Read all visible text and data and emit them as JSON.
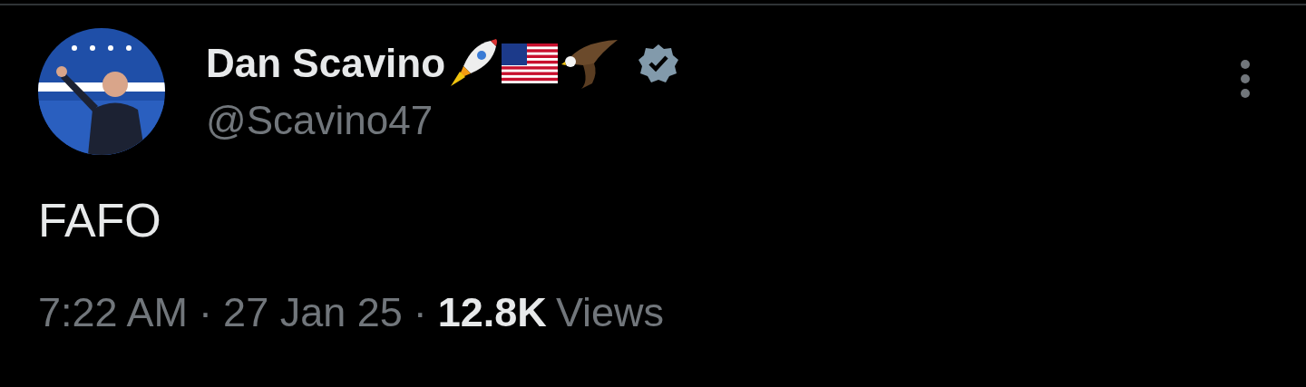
{
  "tweet": {
    "author": {
      "display_name": "Dan Scavino",
      "verified": true,
      "handle": "@Scavino47"
    },
    "text": "FAFO",
    "meta": {
      "time": "7:22 AM",
      "separator_1": "·",
      "date": "27 Jan 25",
      "separator_2": "·",
      "views_count": "12.8K",
      "views_label": "Views"
    }
  }
}
